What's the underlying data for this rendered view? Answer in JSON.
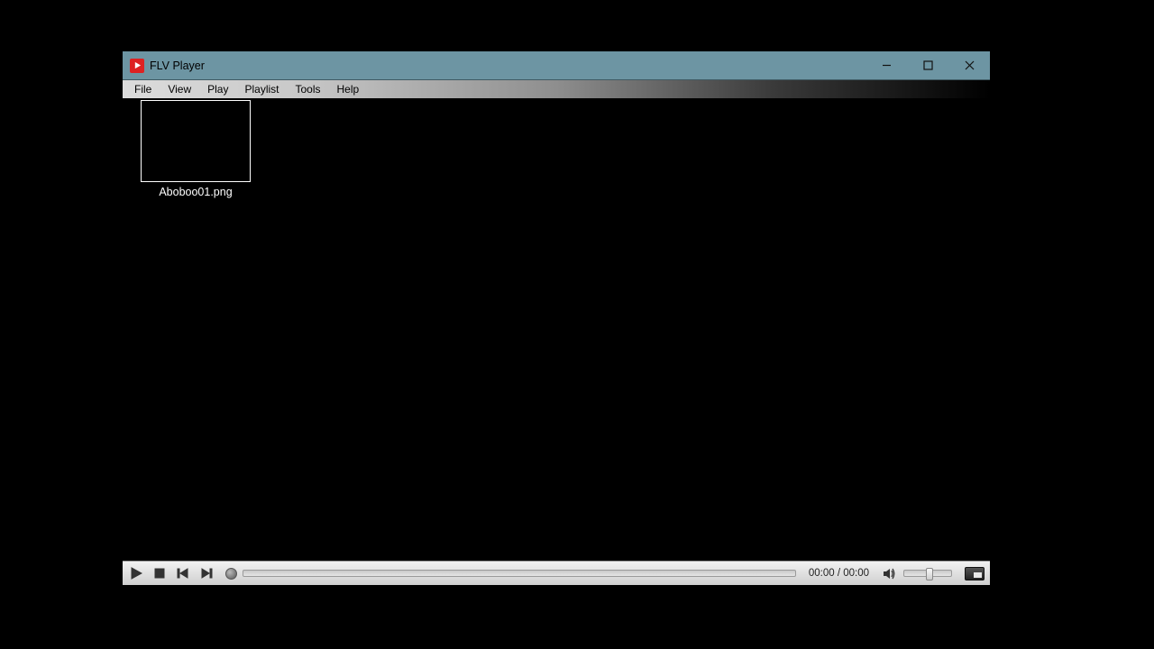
{
  "window": {
    "title": "FLV Player"
  },
  "menu": {
    "items": [
      "File",
      "View",
      "Play",
      "Playlist",
      "Tools",
      "Help"
    ]
  },
  "content": {
    "thumbnail": {
      "filename": "Aboboo01.png"
    }
  },
  "controls": {
    "time_current": "00:00",
    "time_total": "00:00",
    "time_display": "00:00 / 00:00"
  }
}
